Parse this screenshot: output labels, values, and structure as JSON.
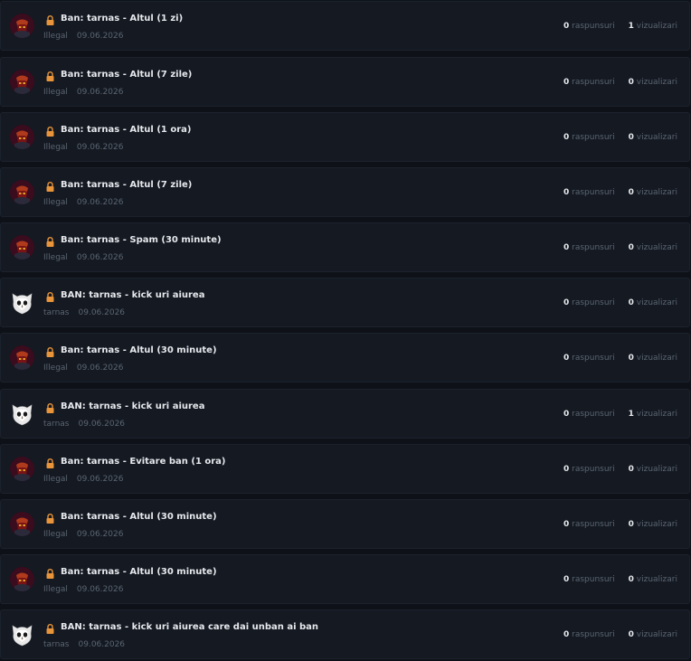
{
  "topics": [
    {
      "title": "Ban: tarnas - Altul (1 zi)",
      "author": "Illegal",
      "date": "09.06.2026",
      "replies": "0",
      "replies_label": "raspunsuri",
      "views": "1",
      "views_label": "vizualizari",
      "avatar": "illegal-avatar"
    },
    {
      "title": "Ban: tarnas - Altul (7 zile)",
      "author": "Illegal",
      "date": "09.06.2026",
      "replies": "0",
      "replies_label": "raspunsuri",
      "views": "0",
      "views_label": "vizualizari",
      "avatar": "illegal-avatar"
    },
    {
      "title": "Ban: tarnas - Altul (1 ora)",
      "author": "Illegal",
      "date": "09.06.2026",
      "replies": "0",
      "replies_label": "raspunsuri",
      "views": "0",
      "views_label": "vizualizari",
      "avatar": "illegal-avatar"
    },
    {
      "title": "Ban: tarnas - Altul (7 zile)",
      "author": "Illegal",
      "date": "09.06.2026",
      "replies": "0",
      "replies_label": "raspunsuri",
      "views": "0",
      "views_label": "vizualizari",
      "avatar": "illegal-avatar"
    },
    {
      "title": "Ban: tarnas - Spam (30 minute)",
      "author": "Illegal",
      "date": "09.06.2026",
      "replies": "0",
      "replies_label": "raspunsuri",
      "views": "0",
      "views_label": "vizualizari",
      "avatar": "illegal-avatar"
    },
    {
      "title": "BAN: tarnas - kick uri aiurea",
      "author": "tarnas",
      "date": "09.06.2026",
      "replies": "0",
      "replies_label": "raspunsuri",
      "views": "0",
      "views_label": "vizualizari",
      "avatar": "owl-avatar"
    },
    {
      "title": "Ban: tarnas - Altul (30 minute)",
      "author": "Illegal",
      "date": "09.06.2026",
      "replies": "0",
      "replies_label": "raspunsuri",
      "views": "0",
      "views_label": "vizualizari",
      "avatar": "illegal-avatar"
    },
    {
      "title": "BAN: tarnas - kick uri aiurea",
      "author": "tarnas",
      "date": "09.06.2026",
      "replies": "0",
      "replies_label": "raspunsuri",
      "views": "1",
      "views_label": "vizualizari",
      "avatar": "owl-avatar"
    },
    {
      "title": "Ban: tarnas - Evitare ban (1 ora)",
      "author": "Illegal",
      "date": "09.06.2026",
      "replies": "0",
      "replies_label": "raspunsuri",
      "views": "0",
      "views_label": "vizualizari",
      "avatar": "illegal-avatar"
    },
    {
      "title": "Ban: tarnas - Altul (30 minute)",
      "author": "Illegal",
      "date": "09.06.2026",
      "replies": "0",
      "replies_label": "raspunsuri",
      "views": "0",
      "views_label": "vizualizari",
      "avatar": "illegal-avatar"
    },
    {
      "title": "Ban: tarnas - Altul (30 minute)",
      "author": "Illegal",
      "date": "09.06.2026",
      "replies": "0",
      "replies_label": "raspunsuri",
      "views": "0",
      "views_label": "vizualizari",
      "avatar": "illegal-avatar"
    },
    {
      "title": "BAN: tarnas - kick uri aiurea care dai unban ai ban",
      "author": "tarnas",
      "date": "09.06.2026",
      "replies": "0",
      "replies_label": "raspunsuri",
      "views": "0",
      "views_label": "vizualizari",
      "avatar": "owl-avatar"
    }
  ],
  "icons": {
    "lock": "lock-icon",
    "lock_color": "#e8943a"
  },
  "colors": {
    "background": "#0e1218",
    "row_background": "#141922",
    "title_text": "#e6e8ec",
    "muted_text": "#5c6570"
  }
}
